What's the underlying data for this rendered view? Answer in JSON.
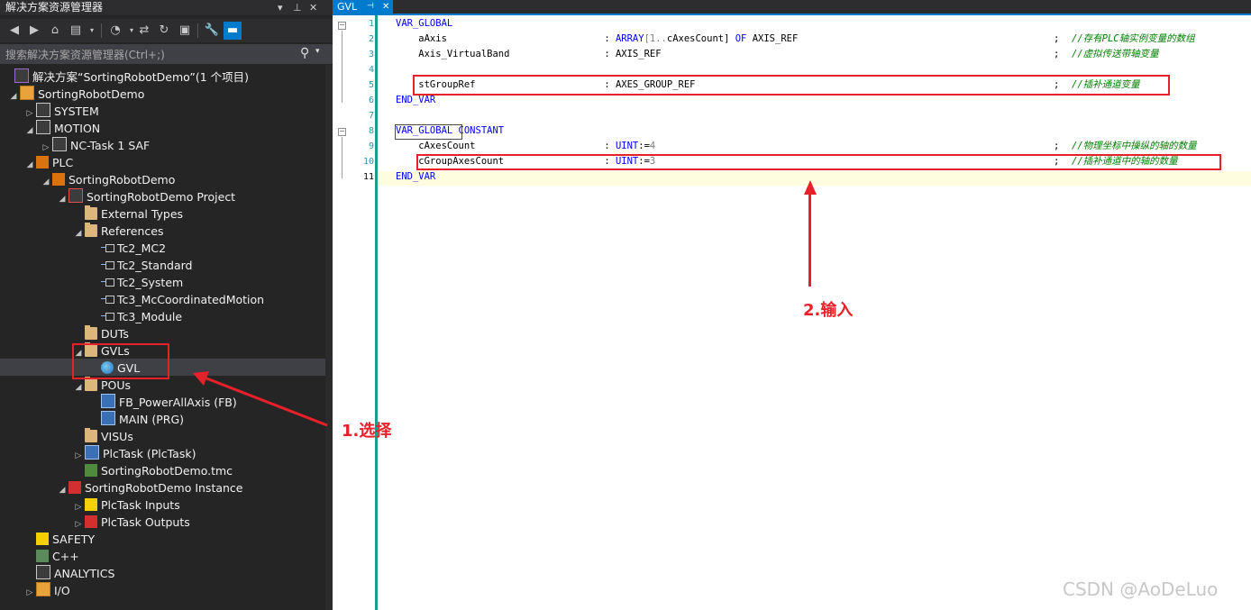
{
  "explorer": {
    "title": "解决方案资源管理器",
    "title_buttons": [
      "▾",
      "⊥",
      "✕"
    ],
    "search_placeholder": "搜索解决方案资源管理器(Ctrl+;)",
    "tree": [
      {
        "label": "解决方案“SortingRobotDemo”(1 个项目)"
      },
      {
        "label": "SortingRobotDemo"
      },
      {
        "label": "SYSTEM"
      },
      {
        "label": "MOTION"
      },
      {
        "label": "NC-Task 1 SAF"
      },
      {
        "label": "PLC"
      },
      {
        "label": "SortingRobotDemo"
      },
      {
        "label": "SortingRobotDemo Project"
      },
      {
        "label": "External Types"
      },
      {
        "label": "References"
      },
      {
        "label": "Tc2_MC2"
      },
      {
        "label": "Tc2_Standard"
      },
      {
        "label": "Tc2_System"
      },
      {
        "label": "Tc3_McCoordinatedMotion"
      },
      {
        "label": "Tc3_Module"
      },
      {
        "label": "DUTs"
      },
      {
        "label": "GVLs"
      },
      {
        "label": "GVL"
      },
      {
        "label": "POUs"
      },
      {
        "label": "FB_PowerAllAxis (FB)"
      },
      {
        "label": "MAIN (PRG)"
      },
      {
        "label": "VISUs"
      },
      {
        "label": "PlcTask (PlcTask)"
      },
      {
        "label": "SortingRobotDemo.tmc"
      },
      {
        "label": "SortingRobotDemo Instance"
      },
      {
        "label": "PlcTask Inputs"
      },
      {
        "label": "PlcTask Outputs"
      },
      {
        "label": "SAFETY"
      },
      {
        "label": "C++"
      },
      {
        "label": "ANALYTICS"
      },
      {
        "label": "I/O"
      }
    ]
  },
  "editor": {
    "tab_title": "GVL",
    "tab_pin": "⊣",
    "tab_close": "✕",
    "line_numbers": [
      "1",
      "2",
      "3",
      "4",
      "5",
      "6",
      "7",
      "8",
      "9",
      "10",
      "11"
    ],
    "lines": {
      "l1": "VAR_GLOBAL",
      "l2_name": "    aAxis",
      "l2_colon": " : ",
      "l2_type1": "ARRAY",
      "l2_num": "[1..",
      "l2_rest": "cAxesCount] ",
      "l2_of": "OF",
      "l2_type2": " AXIS_REF",
      "l2_semi": ";",
      "l2_comment": "//存有PLC轴实例变量的数组",
      "l3_name": "    Axis_VirtualBand",
      "l3_type": " : AXIS_REF",
      "l3_semi": ";",
      "l3_comment": "//虚拟传送带轴变量",
      "l5_name": "    stGroupRef",
      "l5_type": " : AXES_GROUP_REF",
      "l5_semi": ";",
      "l5_comment": "//插补通道变量",
      "l6": "END_VAR",
      "l8_kw": "VAR_GLOBAL",
      "l8_kw2": " CONSTANT",
      "l9_name": "    cAxesCount",
      "l9_colon": " : ",
      "l9_type": "UINT",
      "l9_assign": ":=",
      "l9_val": "4",
      "l9_semi": ";",
      "l9_comment": "//物理坐标中操纵的轴的数量",
      "l10_name": "    cGroupAxesCount",
      "l10_colon": " : ",
      "l10_type": "UINT",
      "l10_assign": ":=",
      "l10_val": "3",
      "l10_semi": ";",
      "l10_comment": "//插补通道中的轴的数量",
      "l11": "END_VAR"
    }
  },
  "annotations": {
    "step1": "1.选择",
    "step2": "2.输入"
  },
  "watermark": "CSDN @AoDeLuo",
  "colors": {
    "accent": "#007acc",
    "annotation_red": "#e8202a",
    "keyword_blue": "#0000ff",
    "comment_green": "#008000"
  }
}
